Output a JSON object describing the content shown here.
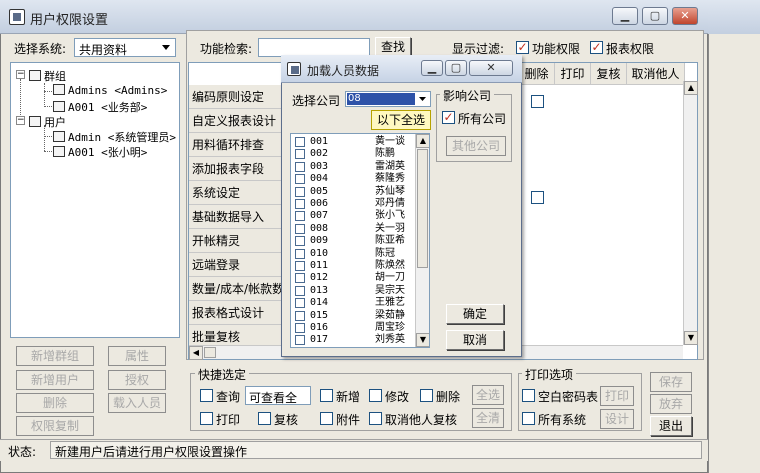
{
  "main_window": {
    "title": "用户权限设置",
    "system_label": "选择系统:",
    "system_value": "共用资料",
    "tree": {
      "group_label": "群组",
      "groups": [
        "Admins <Admins>",
        "A001 <业务部>"
      ],
      "user_label": "用户",
      "users": [
        "Admin <系统管理员>",
        "A001 <张小明>"
      ]
    },
    "left_buttons": [
      "新增群组",
      "属性",
      "新增用户",
      "授权",
      "删除",
      "载入人员",
      "权限复制"
    ],
    "function_search_label": "功能检索:",
    "search_button": "查找",
    "filter_label": "显示过滤:",
    "filter_options": [
      {
        "label": "功能权限",
        "checked": true
      },
      {
        "label": "报表权限",
        "checked": true
      }
    ],
    "column_headers": [
      "删除",
      "打印",
      "复核",
      "取消他人"
    ],
    "function_rows": [
      "编码原则设定",
      "自定义报表设计",
      "用料循环排查",
      "添加报表字段",
      "系统设定",
      "基础数据导入",
      "开帐精灵",
      "远端登录",
      "数量/成本/帐款数",
      "报表格式设计",
      "批量复核"
    ],
    "quick_select": {
      "title": "快捷选定",
      "items": [
        "查询",
        "新增",
        "修改",
        "删除",
        "打印",
        "复核",
        "附件",
        "取消他人复核"
      ],
      "view_combo": "可查看全",
      "select_all": "全选",
      "clear_all": "全清"
    },
    "print_options": {
      "title": "打印选项",
      "items": [
        "空白密码表",
        "所有系统"
      ],
      "print_button": "打印",
      "design_button": "设计"
    },
    "right_buttons": [
      "保存",
      "放弃",
      "退出"
    ],
    "status_label": "状态:",
    "status_text": "新建用户后请进行用户权限设置操作"
  },
  "dialog": {
    "title": "加载人员数据",
    "company_label": "选择公司",
    "company_value": "08",
    "select_below_all": "以下全选",
    "affect_company_label": "影响公司",
    "all_companies_label": "所有公司",
    "all_companies_checked": true,
    "other_company_button": "其他公司",
    "confirm_button": "确定",
    "cancel_button": "取消",
    "people": [
      {
        "code": "001",
        "name": "黄一谈"
      },
      {
        "code": "002",
        "name": "陈鹏"
      },
      {
        "code": "003",
        "name": "雷湖英"
      },
      {
        "code": "004",
        "name": "蔡隆秀"
      },
      {
        "code": "005",
        "name": "苏仙琴"
      },
      {
        "code": "006",
        "name": "邓丹倩"
      },
      {
        "code": "007",
        "name": "张小飞"
      },
      {
        "code": "008",
        "name": "关一羽"
      },
      {
        "code": "009",
        "name": "陈亚希"
      },
      {
        "code": "010",
        "name": "陈冠"
      },
      {
        "code": "011",
        "name": "陈焕然"
      },
      {
        "code": "012",
        "name": "胡一刀"
      },
      {
        "code": "013",
        "name": "吴宗天"
      },
      {
        "code": "014",
        "name": "王雅艺"
      },
      {
        "code": "015",
        "name": "梁茹静"
      },
      {
        "code": "016",
        "name": "周宝珍"
      },
      {
        "code": "017",
        "name": "刘秀英"
      }
    ]
  },
  "colors": {
    "window_bg": "#ece9e0",
    "check_mark": "#c03020",
    "selection": "#2d52a8"
  },
  "icons": [
    "app-icon",
    "minimize-icon",
    "maximize-icon",
    "close-icon",
    "group-icon",
    "user-icon",
    "dropdown-arrow-icon",
    "scroll-up-icon",
    "scroll-down-icon"
  ]
}
